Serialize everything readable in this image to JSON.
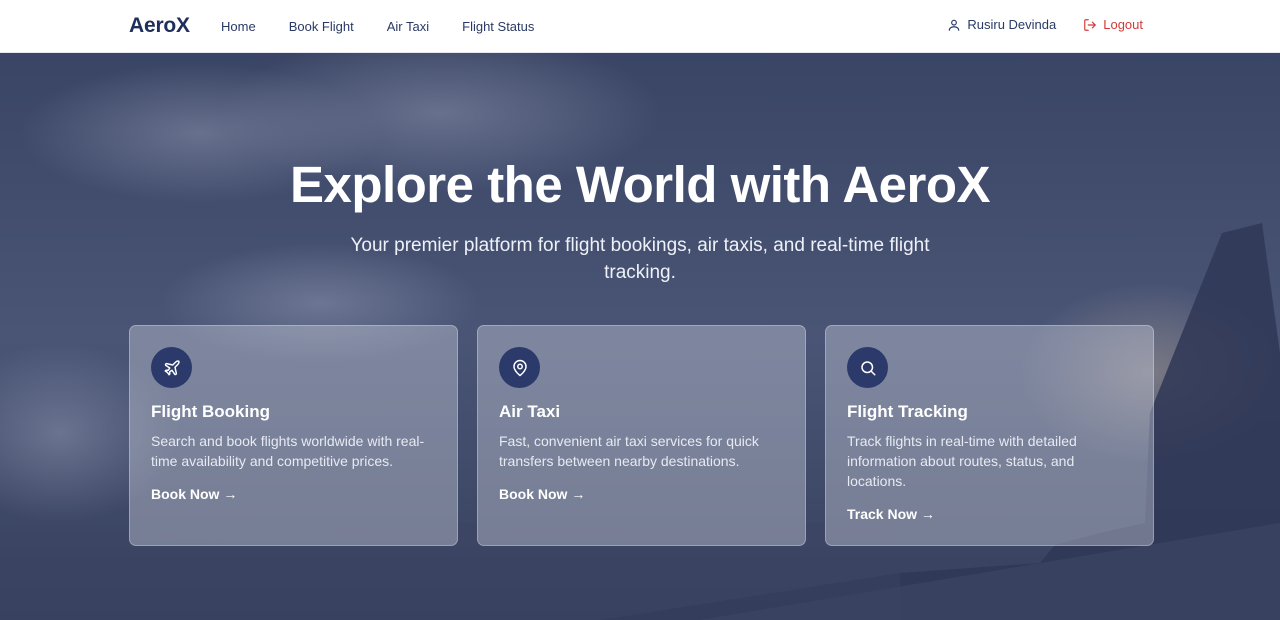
{
  "brand": {
    "name": "AeroX"
  },
  "nav": {
    "links": [
      "Home",
      "Book Flight",
      "Air Taxi",
      "Flight Status"
    ]
  },
  "user": {
    "name": "Rusiru Devinda",
    "icon": "user-icon",
    "logout_label": "Logout",
    "logout_icon": "logout-icon"
  },
  "hero": {
    "title": "Explore the World with AeroX",
    "subtitle": "Your premier platform for flight bookings, air taxis, and real-time flight tracking."
  },
  "cards": [
    {
      "icon": "plane-icon",
      "title": "Flight Booking",
      "description": "Search and book flights worldwide with real-time availability and competitive prices.",
      "link": "Book Now →"
    },
    {
      "icon": "location-pin-icon",
      "title": "Air Taxi",
      "description": "Fast, convenient air taxi services for quick transfers between nearby destinations.",
      "link": "Book Now →"
    },
    {
      "icon": "search-icon",
      "title": "Flight Tracking",
      "description": "Track flights in real-time with detailed information about routes, status, and locations.",
      "link": "Track Now →"
    }
  ],
  "colors": {
    "brand": "#1f2f5c",
    "nav_text": "#2a3a66",
    "logout": "#d23a3a",
    "icon_circle": "#2b3a6b"
  }
}
